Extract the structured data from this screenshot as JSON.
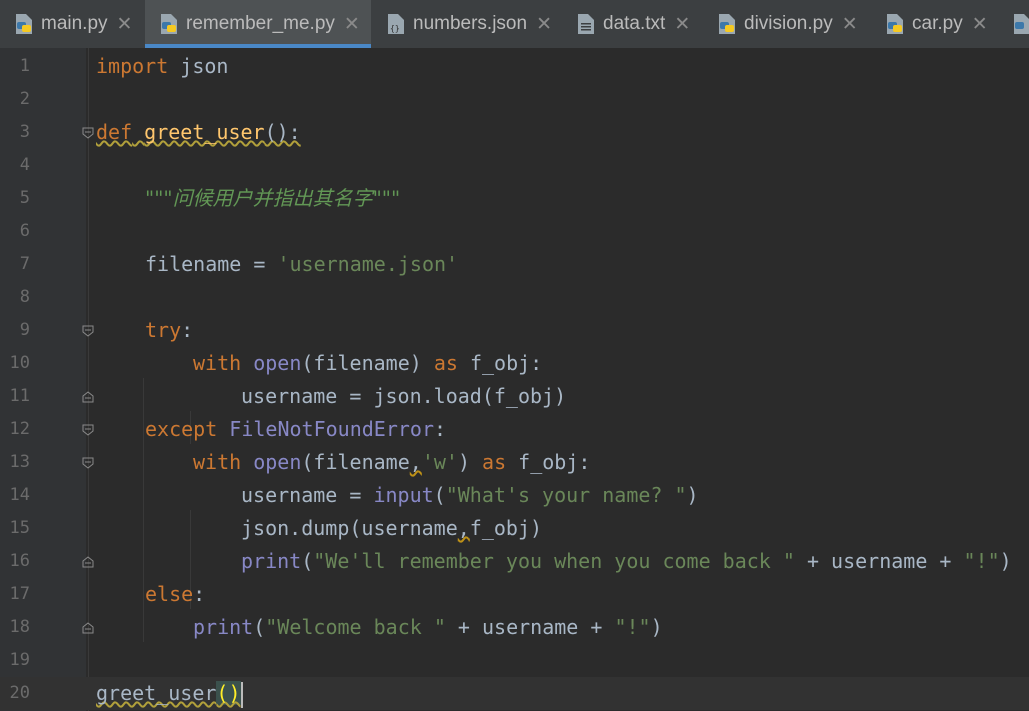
{
  "tabs": [
    {
      "label": "main.py",
      "icon": "python-file-icon",
      "active": false
    },
    {
      "label": "remember_me.py",
      "icon": "python-file-icon",
      "active": true
    },
    {
      "label": "numbers.json",
      "icon": "json-file-icon",
      "active": false
    },
    {
      "label": "data.txt",
      "icon": "text-file-icon",
      "active": false
    },
    {
      "label": "division.py",
      "icon": "python-file-icon",
      "active": false
    },
    {
      "label": "car.py",
      "icon": "python-file-icon",
      "active": false
    }
  ],
  "close_glyph": "✕",
  "line_numbers": [
    "1",
    "2",
    "3",
    "4",
    "5",
    "6",
    "7",
    "8",
    "9",
    "10",
    "11",
    "12",
    "13",
    "14",
    "15",
    "16",
    "17",
    "18",
    "19",
    "20"
  ],
  "code": {
    "l1": {
      "kw": "import",
      "rest": " json"
    },
    "l3": {
      "kw": "def",
      "fn": "greet_user",
      "rest": "():"
    },
    "l5": {
      "doc": "\"\"\"问候用户并指出其名字\"\"\""
    },
    "l7": {
      "a": "filename = ",
      "str": "'username.json'"
    },
    "l9": {
      "kw": "try",
      "rest": ":"
    },
    "l10": {
      "kw": "with",
      "bi": "open",
      "a": "(filename) ",
      "kw2": "as",
      "b": " f_obj:"
    },
    "l11": {
      "a": "username = json.load(f_obj)"
    },
    "l12": {
      "kw": "except",
      "bi": "FileNotFoundError",
      "rest": ":"
    },
    "l13": {
      "kw": "with",
      "bi": "open",
      "a": "(filename",
      "comma": ",",
      "str": "'w'",
      "b": ") ",
      "kw2": "as",
      "c": " f_obj:"
    },
    "l14": {
      "a": "username = ",
      "bi": "input",
      "b": "(",
      "str": "\"What's your name? \"",
      "c": ")"
    },
    "l15": {
      "a": "json.dump(username",
      "comma": ",",
      "b": "f_obj)"
    },
    "l16": {
      "bi": "print",
      "a": "(",
      "str": "\"We'll remember you when you come back \"",
      "b": " + username + ",
      "str2": "\"!\"",
      "c": ")"
    },
    "l17": {
      "kw": "else",
      "rest": ":"
    },
    "l18": {
      "bi": "print",
      "a": "(",
      "str": "\"Welcome back \"",
      "b": " + username + ",
      "str2": "\"!\"",
      "c": ")"
    },
    "l20": {
      "fn": "greet_user",
      "paren": "()"
    }
  },
  "colors": {
    "background": "#2b2b2b",
    "keyword": "#cc7832",
    "function": "#ffc66d",
    "builtin": "#8888c6",
    "string": "#6a8759",
    "docstring": "#629755",
    "text": "#a9b7c6",
    "active_tab_underline": "#4a88c7"
  }
}
